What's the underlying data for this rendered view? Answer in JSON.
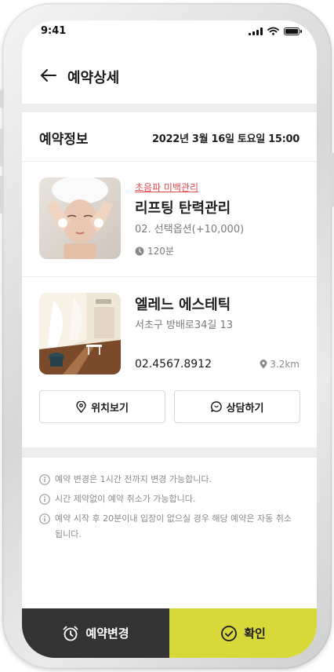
{
  "status": {
    "time": "9:41"
  },
  "header": {
    "title": "예약상세",
    "back_icon": "arrow-left-icon"
  },
  "reservation": {
    "label": "예약정보",
    "datetime": "2022년 3월 16일 토요일 15:00"
  },
  "service": {
    "category": "초음파 미백관리",
    "name": "리프팅 탄력관리",
    "option": "02. 선택옵션(+10,000)",
    "duration": "120분",
    "duration_icon": "clock-icon"
  },
  "shop": {
    "name": "엘레느 에스테틱",
    "address": "서초구 방배로34길 13",
    "phone": "02.4567.8912",
    "distance": "3.2km",
    "location_button": "위치보기",
    "consult_button": "상담하기"
  },
  "notes": [
    "예약 변경은 1시간 전까지 변경 가능합니다.",
    "시간 제약없이 예약 취소가 가능합니다.",
    "예약 시작 후 20분이내 입장이 없으실 경우 해당 예약은 자동 취소됩니다."
  ],
  "footer": {
    "change_label": "예약변경",
    "confirm_label": "확인"
  },
  "colors": {
    "accent_yellow": "#d9d83a",
    "dark_button": "#333333",
    "category_red": "#e04a4a"
  }
}
